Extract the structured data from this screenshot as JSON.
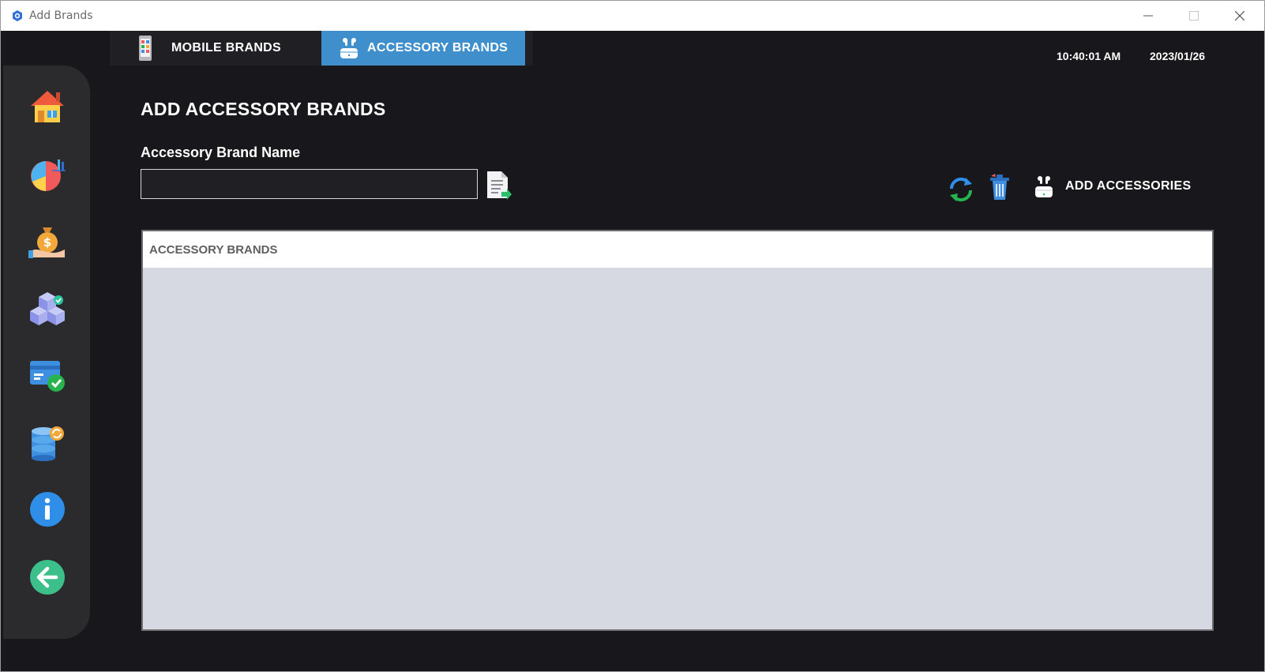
{
  "window": {
    "title": "Add Brands"
  },
  "sidebar": {
    "items": [
      {
        "name": "home",
        "icon": "home-icon"
      },
      {
        "name": "reports",
        "icon": "pie-chart-icon"
      },
      {
        "name": "sales",
        "icon": "money-bag-icon"
      },
      {
        "name": "inventory",
        "icon": "boxes-icon"
      },
      {
        "name": "payments",
        "icon": "card-check-icon"
      },
      {
        "name": "database",
        "icon": "database-sync-icon"
      },
      {
        "name": "about",
        "icon": "info-icon"
      },
      {
        "name": "back",
        "icon": "back-arrow-icon"
      }
    ]
  },
  "tabs": [
    {
      "label": "MOBILE BRANDS",
      "icon": "phone-icon",
      "active": false
    },
    {
      "label": "ACCESSORY BRANDS",
      "icon": "earbuds-icon",
      "active": true
    }
  ],
  "clock": {
    "time": "10:40:01 AM",
    "date": "2023/01/26"
  },
  "main": {
    "title": "ADD ACCESSORY BRANDS",
    "field_label": "Accessory Brand Name",
    "brand_input": {
      "value": "",
      "placeholder": ""
    },
    "add_button_label": "ADD ACCESSORIES"
  },
  "table": {
    "columns": [
      "ACCESSORY BRANDS"
    ],
    "rows": []
  },
  "colors": {
    "background": "#17171c",
    "sidebar": "#2b2b2d",
    "active_tab": "#3f8fcd",
    "table_body": "#d6d9e1"
  }
}
